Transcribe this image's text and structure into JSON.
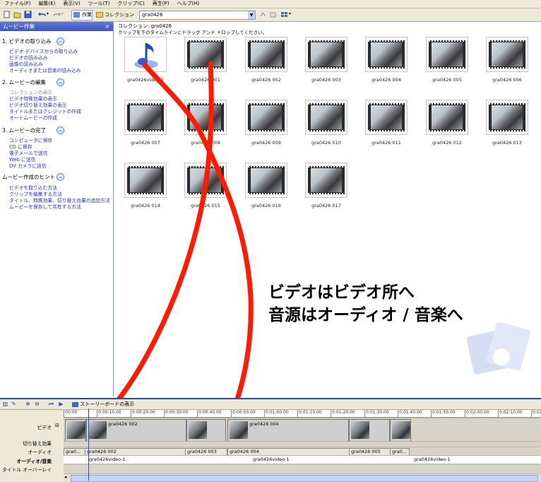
{
  "menubar": [
    "ファイル(F)",
    "編集(E)",
    "表示(V)",
    "ツール(T)",
    "クリップ(C)",
    "再生(P)",
    "ヘルプ(H)"
  ],
  "toolbar": {
    "tasks_label": "作業",
    "collections_label": "コレクション",
    "collection_selected": "gra0426"
  },
  "tasks": {
    "header": "ムービー作業",
    "close": "×",
    "sections": [
      {
        "title": "1. ビデオの取り込み",
        "items": [
          "ビデオ デバイスからの取り込み",
          "ビデオの読み込み",
          "画像の読み込み",
          "オーディオまたは音楽の読み込み"
        ]
      },
      {
        "title": "2. ムービーの編集",
        "items": [
          "コレクションの表示",
          "ビデオ特殊効果の表示",
          "ビデオ切り替え効果の表示",
          "タイトルまたはクレジットの作成",
          "オートムービーの作成"
        ]
      },
      {
        "title": "3. ムービーの完了",
        "items": [
          "コンピュータに保存",
          "CD に保存",
          "電子メールで送信",
          "Web に送信",
          "DV カメラに送信"
        ]
      },
      {
        "title": "ムービー作成のヒント",
        "items": [
          "ビデオを取り込む方法",
          "クリップを編集する方法",
          "タイトル、特殊効果、切り替え効果の追加方法",
          "ムービーを保存して共有する方法"
        ]
      }
    ]
  },
  "collection": {
    "title": "コレクション: gra0426",
    "hint": "クリップを下のタイムラインにドラッグ アンド ドロップしてください。",
    "clips": [
      "gra0426video-1",
      "gra0426 001",
      "gra0426 002",
      "gra0426 003",
      "gra0426 004",
      "gra0426 005",
      "gra0426 006",
      "gra0426 007",
      "gra0426 008",
      "gra0426 009",
      "gra0426 010",
      "gra0426 011",
      "gra0426 012",
      "gra0426 013",
      "gra0426 014",
      "gra0426 015",
      "gra0426 016",
      "gra0426 017"
    ]
  },
  "overlay": {
    "line1": "ビデオはビデオ所へ",
    "line2": "音源はオーディオ / 音楽へ"
  },
  "timeline": {
    "storyboard_label": "ストーリーボードの表示",
    "ruler": [
      "00:00",
      "0:00:10.00",
      "0:00:20.00",
      "0:00:30.00",
      "0:00:40.00",
      "0:00:50.00",
      "0:01:00.00",
      "0:01:10.00",
      "0:01:20.00",
      "0:01:30.00",
      "0:01:40.00",
      "0:01:50.00",
      "0:02:00.00",
      "0:02:10.00",
      "0:02:2"
    ],
    "tracks": {
      "video": "ビデオ",
      "transition": "切り替え効果",
      "audio": "オーディオ",
      "music": "オーディオ/音楽",
      "title_overlay": "タイトル オーバーレイ"
    },
    "video_clips": [
      "gra0426 002",
      "gra0426 004",
      "gr..."
    ],
    "audio_clips": [
      "gra0...",
      "gra0426 002",
      "gra0426 003",
      "gra0426 004",
      "gra0426 005",
      "gra0..."
    ],
    "music_clips": [
      "gra0426video-1",
      "gra0426video-1",
      "gra0426video-1"
    ]
  }
}
